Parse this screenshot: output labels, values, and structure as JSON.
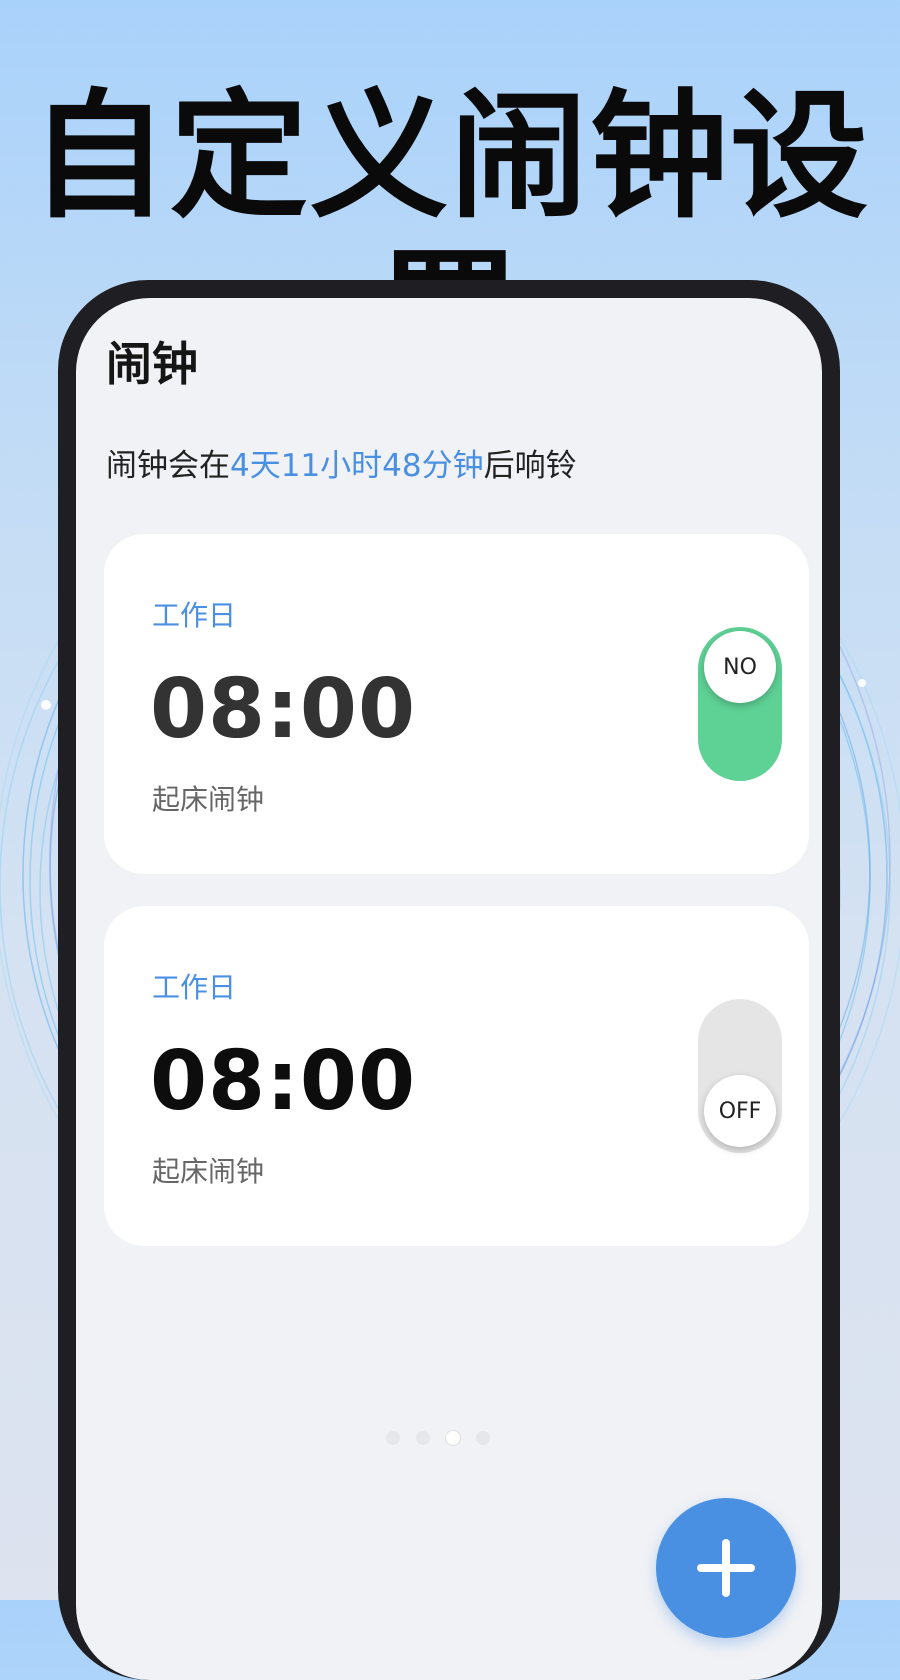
{
  "headline": "自定义闹钟设置",
  "app": {
    "title": "闹钟",
    "countdown": {
      "prefix": "闹钟会在",
      "highlight": "4天11小时48分钟",
      "suffix": "后响铃"
    }
  },
  "alarms": [
    {
      "repeat": "工作日",
      "time": "08:00",
      "label": "起床闹钟",
      "toggle_text": "NO",
      "enabled": true
    },
    {
      "repeat": "工作日",
      "time": "08:00",
      "label": "起床闹钟",
      "toggle_text": "OFF",
      "enabled": false
    }
  ],
  "pager": {
    "count": 4,
    "active_index": 2
  },
  "colors": {
    "accent": "#4a90e2",
    "toggle_on": "#5ed195",
    "toggle_off": "#e5e5e6"
  },
  "icons": {
    "fab": "plus-icon"
  }
}
